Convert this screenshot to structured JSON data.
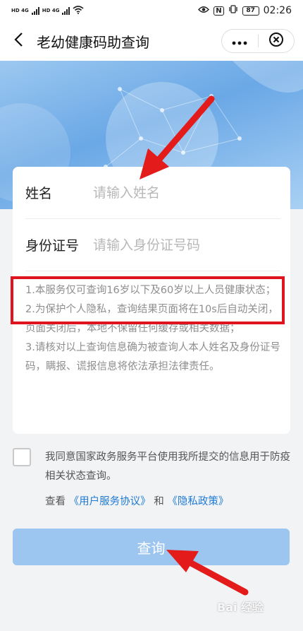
{
  "status_bar": {
    "sim1": "HD 4G",
    "sim2": "HD 4G",
    "nfc": "N",
    "battery": "87",
    "time": "02:26"
  },
  "header": {
    "title": "老幼健康码助查询",
    "back_icon": "chevron-left-icon",
    "more_icon": "more-dots-icon",
    "close_icon": "close-circle-icon"
  },
  "form": {
    "name_label": "姓名",
    "name_placeholder": "请输入姓名",
    "id_label": "身份证号",
    "id_placeholder": "请输入身份证号码"
  },
  "notes": [
    "1.本服务仅可查询16岁以下及60岁以上人员健康状态；",
    "2.为保护个人隐私，查询结果页面将在10s后自动关闭，页面关闭后，本地不保留任何缓存或相关数据；",
    "3.请核对以上查询信息确为被查询人本人姓名及身份证号码，瞒报、谎报信息将依法承担法律责任。"
  ],
  "consent": {
    "text": "我同意国家政务服务平台使用我所提交的信息用于防疫相关状态查询。",
    "view_prefix": "查看",
    "link_user_agreement": "《用户服务协议》",
    "and": "和",
    "link_privacy": "《隐私政策》",
    "checked": false
  },
  "query_button": "查询",
  "watermark": "Bai 经验",
  "colors": {
    "link": "#1f7bd6",
    "button": "#9cc6ef",
    "annotation": "#e0141e"
  }
}
